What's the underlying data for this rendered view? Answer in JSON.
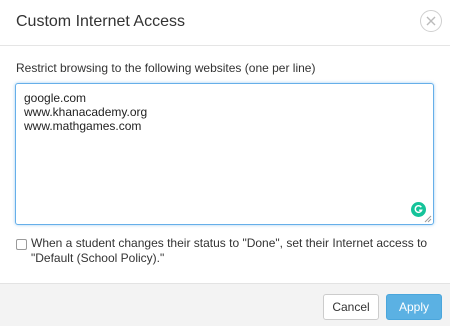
{
  "dialog": {
    "title": "Custom Internet Access",
    "close_icon": "close-icon"
  },
  "form": {
    "instruction": "Restrict browsing to the following websites (one per line)",
    "websites": [
      "google.com",
      "www.khanacademy.org",
      "www.mathgames.com"
    ],
    "checkbox": {
      "checked": false,
      "label": "When a student changes their status to \"Done\", set their Internet access to \"Default (School Policy).\""
    }
  },
  "footer": {
    "cancel_label": "Cancel",
    "apply_label": "Apply"
  },
  "colors": {
    "focus_border": "#66afe9",
    "apply_button": "#5bb1e3",
    "grammarly": "#15c39a"
  }
}
